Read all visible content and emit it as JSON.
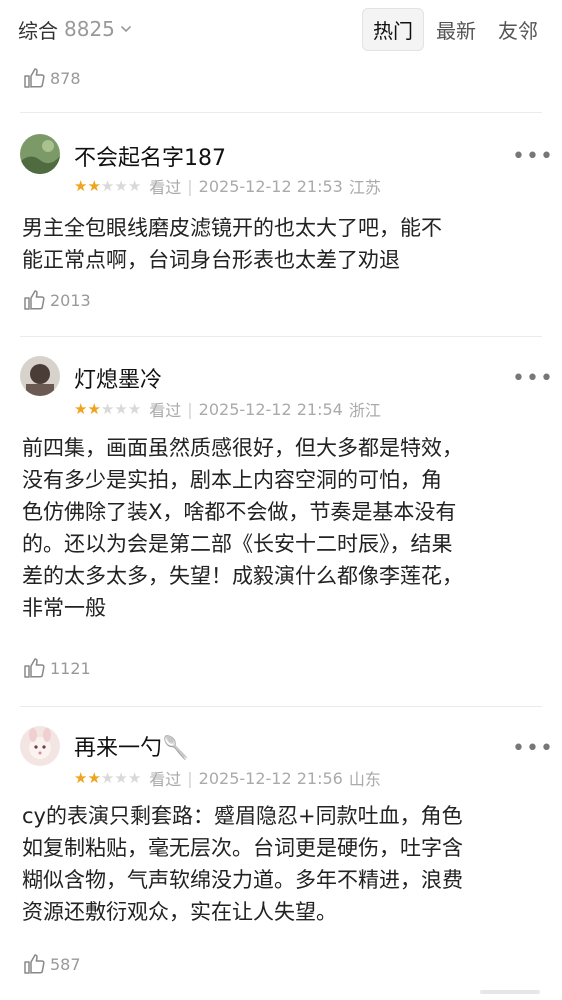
{
  "header": {
    "filter_label": "综合",
    "filter_count": "8825",
    "tabs": [
      "热门",
      "最新",
      "友邻"
    ]
  },
  "top_like_count": "878",
  "reviews": [
    {
      "username": "不会起名字187",
      "rating": 2,
      "status": "看过",
      "datetime": "2025-12-12 21:53",
      "location": "江苏",
      "text": "男主全包眼线磨皮滤镜开的也太大了吧，能不\n能正常点啊，台词身台形表也太差了劝退",
      "likes": "2013",
      "avatar_color": "#6d8a5a"
    },
    {
      "username": "灯熄墨冷",
      "rating": 2,
      "status": "看过",
      "datetime": "2025-12-12 21:54",
      "location": "浙江",
      "text": "前四集，画面虽然质感很好，但大多都是特效，\n没有多少是实拍，剧本上内容空洞的可怕，角\n色仿佛除了装X，啥都不会做，节奏是基本没有\n的。还以为会是第二部《长安十二时辰》，结果\n差的太多太多，失望！成毅演什么都像李莲花，\n非常一般",
      "likes": "1121",
      "avatar_color": "#5a4a44"
    },
    {
      "username": "再来一勺🥄",
      "rating": 2,
      "status": "看过",
      "datetime": "2025-12-12 21:56",
      "location": "山东",
      "text": "cy的表演只剩套路：蹙眉隐忍+同款吐血，角色\n如复制粘贴，毫无层次。台词更是硬伤，吐字含\n糊似含物，气声软绵没力道。多年不精进，浪费\n资源还敷衍观众，实在让人失望。",
      "likes": "587",
      "avatar_color": "#e8c9c4"
    }
  ]
}
